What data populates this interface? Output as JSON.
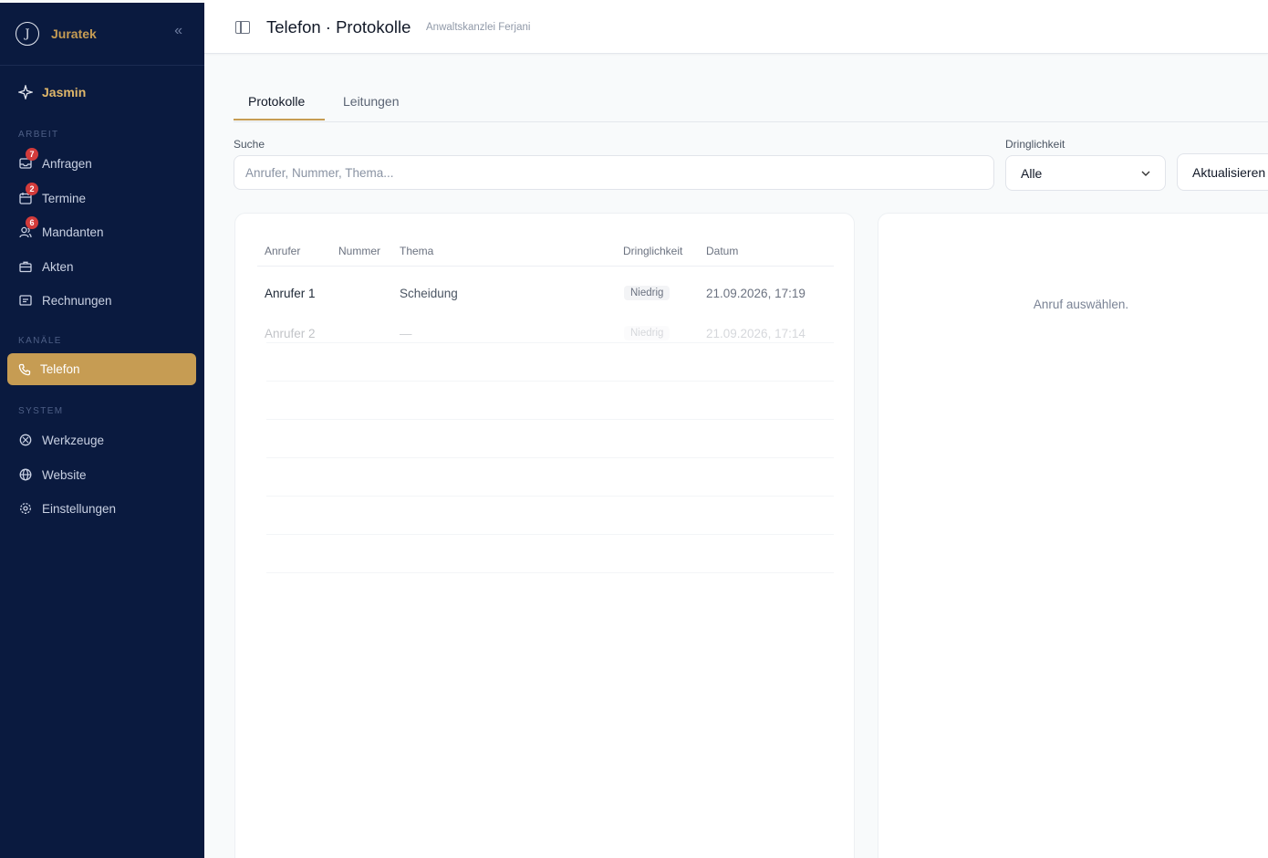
{
  "sidebar": {
    "brand": "Juratek",
    "brand_logo_letter": "J",
    "assistant": "Jasmin",
    "sections": {
      "work": "ARBEIT",
      "channels": "KANÄLE",
      "system": "SYSTEM"
    },
    "items": {
      "anfragen": {
        "label": "Anfragen",
        "badge": "7",
        "icon": "inbox-icon"
      },
      "termine": {
        "label": "Termine",
        "badge": "2",
        "icon": "calendar-icon"
      },
      "mandanten": {
        "label": "Mandanten",
        "badge": "6",
        "icon": "users-icon"
      },
      "akten": {
        "label": "Akten",
        "icon": "briefcase-icon"
      },
      "rechnungen": {
        "label": "Rechnungen",
        "icon": "receipt-icon"
      },
      "telefon": {
        "label": "Telefon",
        "icon": "phone-icon"
      },
      "werkzeuge": {
        "label": "Werkzeuge",
        "icon": "tools-icon"
      },
      "website": {
        "label": "Website",
        "icon": "globe-icon"
      },
      "einstellungen": {
        "label": "Einstellungen",
        "icon": "gear-icon"
      }
    }
  },
  "header": {
    "title": "Telefon · Protokolle",
    "subtitle": "Anwaltskanzlei Ferjani"
  },
  "tabs": {
    "protokolle": "Protokolle",
    "leitungen": "Leitungen"
  },
  "filters": {
    "search_label": "Suche",
    "search_placeholder": "Anrufer, Nummer, Thema...",
    "urgency_label": "Dringlichkeit",
    "urgency_value": "Alle",
    "refresh": "Aktualisieren"
  },
  "table": {
    "columns": {
      "caller": "Anrufer",
      "number": "Nummer",
      "topic": "Thema",
      "urgency": "Dringlichkeit",
      "date": "Datum"
    },
    "rows": [
      {
        "caller": "Anrufer 1",
        "number": "",
        "topic": "Scheidung",
        "urgency": "Niedrig",
        "date": "21.09.2026, 17:19"
      },
      {
        "caller": "Anrufer 2",
        "number": "",
        "topic": "—",
        "urgency": "Niedrig",
        "date": "21.09.2026, 17:14"
      }
    ]
  },
  "detail": {
    "empty": "Anruf auswählen."
  },
  "colors": {
    "sidebar_bg": "#0a1a3f",
    "accent": "#c69c53",
    "badge": "#d23b3b"
  }
}
